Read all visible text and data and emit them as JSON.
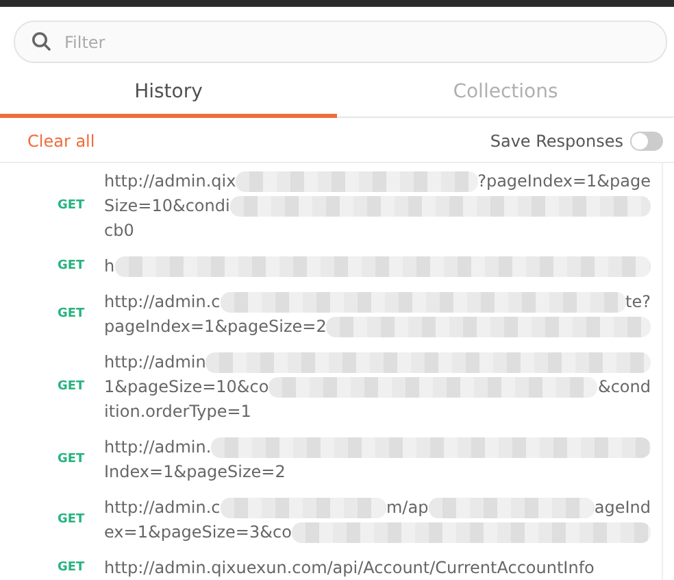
{
  "search": {
    "placeholder": "Filter"
  },
  "tabs": [
    {
      "label": "History",
      "selected": true
    },
    {
      "label": "Collections",
      "selected": false
    }
  ],
  "toolbar": {
    "clear_label": "Clear all",
    "save_responses": {
      "label": "Save Responses",
      "on": false
    }
  },
  "history": [
    {
      "method": "GET",
      "lines": [
        [
          {
            "kind": "text",
            "text": "http://admin.qix"
          },
          {
            "kind": "redacted"
          },
          {
            "kind": "text",
            "text": "?pageIndex=1&page"
          }
        ],
        [
          {
            "kind": "text",
            "text": "Size=10&condi"
          },
          {
            "kind": "redacted"
          }
        ],
        [
          {
            "kind": "text",
            "text": "cb0"
          }
        ]
      ]
    },
    {
      "method": "GET",
      "lines": [
        [
          {
            "kind": "text",
            "text": "h"
          },
          {
            "kind": "redacted"
          }
        ]
      ]
    },
    {
      "method": "GET",
      "lines": [
        [
          {
            "kind": "text",
            "text": "http://admin.c"
          },
          {
            "kind": "redacted"
          },
          {
            "kind": "text",
            "text": "te?"
          }
        ],
        [
          {
            "kind": "text",
            "text": "pageIndex=1&pageSize=2"
          },
          {
            "kind": "redacted"
          }
        ]
      ]
    },
    {
      "method": "GET",
      "lines": [
        [
          {
            "kind": "text",
            "text": "http://admin"
          },
          {
            "kind": "redacted"
          }
        ],
        [
          {
            "kind": "text",
            "text": "1&pageSize=10&co"
          },
          {
            "kind": "redacted"
          },
          {
            "kind": "text",
            "text": "&cond"
          }
        ],
        [
          {
            "kind": "text",
            "text": "ition.orderType=1"
          }
        ]
      ]
    },
    {
      "method": "GET",
      "lines": [
        [
          {
            "kind": "text",
            "text": "http://admin."
          },
          {
            "kind": "redacted"
          }
        ],
        [
          {
            "kind": "text",
            "text": "Index=1&pageSize=2"
          }
        ]
      ]
    },
    {
      "method": "GET",
      "lines": [
        [
          {
            "kind": "text",
            "text": "http://admin.c"
          },
          {
            "kind": "redacted"
          },
          {
            "kind": "text",
            "text": "m/ap"
          },
          {
            "kind": "redacted"
          },
          {
            "kind": "text",
            "text": "ageInd"
          }
        ],
        [
          {
            "kind": "text",
            "text": "ex=1&pageSize=3&co"
          },
          {
            "kind": "redacted"
          }
        ]
      ]
    },
    {
      "method": "GET",
      "lines": [
        [
          {
            "kind": "text",
            "text": "http://admin.qixuexun.com/api/Account/CurrentAccountInfo"
          }
        ]
      ]
    }
  ]
}
